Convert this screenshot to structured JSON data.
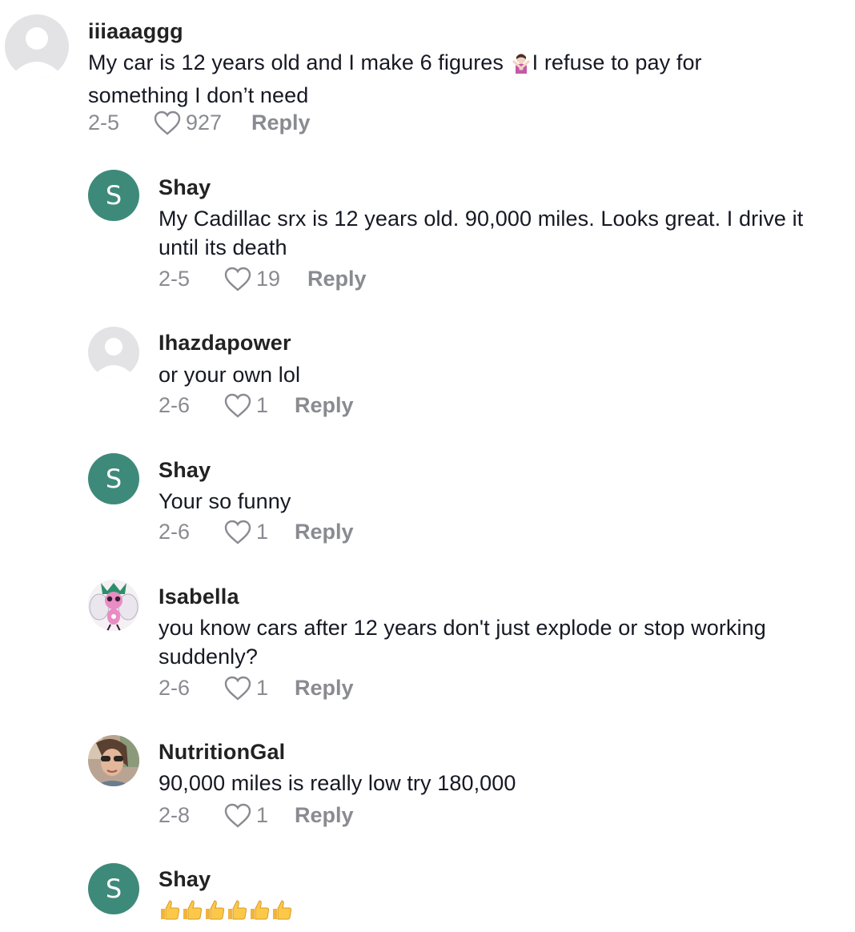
{
  "comments": [
    {
      "username": "iiiaaaggg",
      "text_before": "My car is 12 years old and I make 6 figures ",
      "emoji": "person-gesturing-no-emoji",
      "text_after": "I refuse to pay for something I don’t need",
      "date": "2-5",
      "likes": "927",
      "reply": "Reply",
      "avatar": "default-avatar-icon"
    },
    {
      "username": "Shay",
      "text": "My Cadillac srx is 12 years old. 90,000 miles. Looks great. I drive it until its death",
      "date": "2-5",
      "likes": "19",
      "reply": "Reply",
      "avatar_letter": "S",
      "avatar_color": "#3e8a7a"
    },
    {
      "username": "Ihazdapower",
      "text": "or your own lol",
      "date": "2-6",
      "likes": "1",
      "reply": "Reply",
      "avatar": "default-avatar-icon"
    },
    {
      "username": "Shay",
      "text": "Your so funny",
      "date": "2-6",
      "likes": "1",
      "reply": "Reply",
      "avatar_letter": "S",
      "avatar_color": "#3e8a7a"
    },
    {
      "username": "Isabella",
      "text": "you know cars after 12 years don't just explode or stop working suddenly?",
      "date": "2-6",
      "likes": "1",
      "reply": "Reply",
      "avatar": "pink-creature-avatar"
    },
    {
      "username": "NutritionGal",
      "text": "90,000 miles is really low try 180,000",
      "date": "2-8",
      "likes": "1",
      "reply": "Reply",
      "avatar": "photo-avatar"
    },
    {
      "username": "Shay",
      "text_emoji": "thumbs-up-emoji x6",
      "avatar_letter": "S",
      "avatar_color": "#3e8a7a"
    }
  ],
  "colors": {
    "avatar_green": "#3e8a7a",
    "meta_gray": "#8a8b91",
    "text_dark": "#161823",
    "default_avatar_bg": "#e3e3e6"
  }
}
